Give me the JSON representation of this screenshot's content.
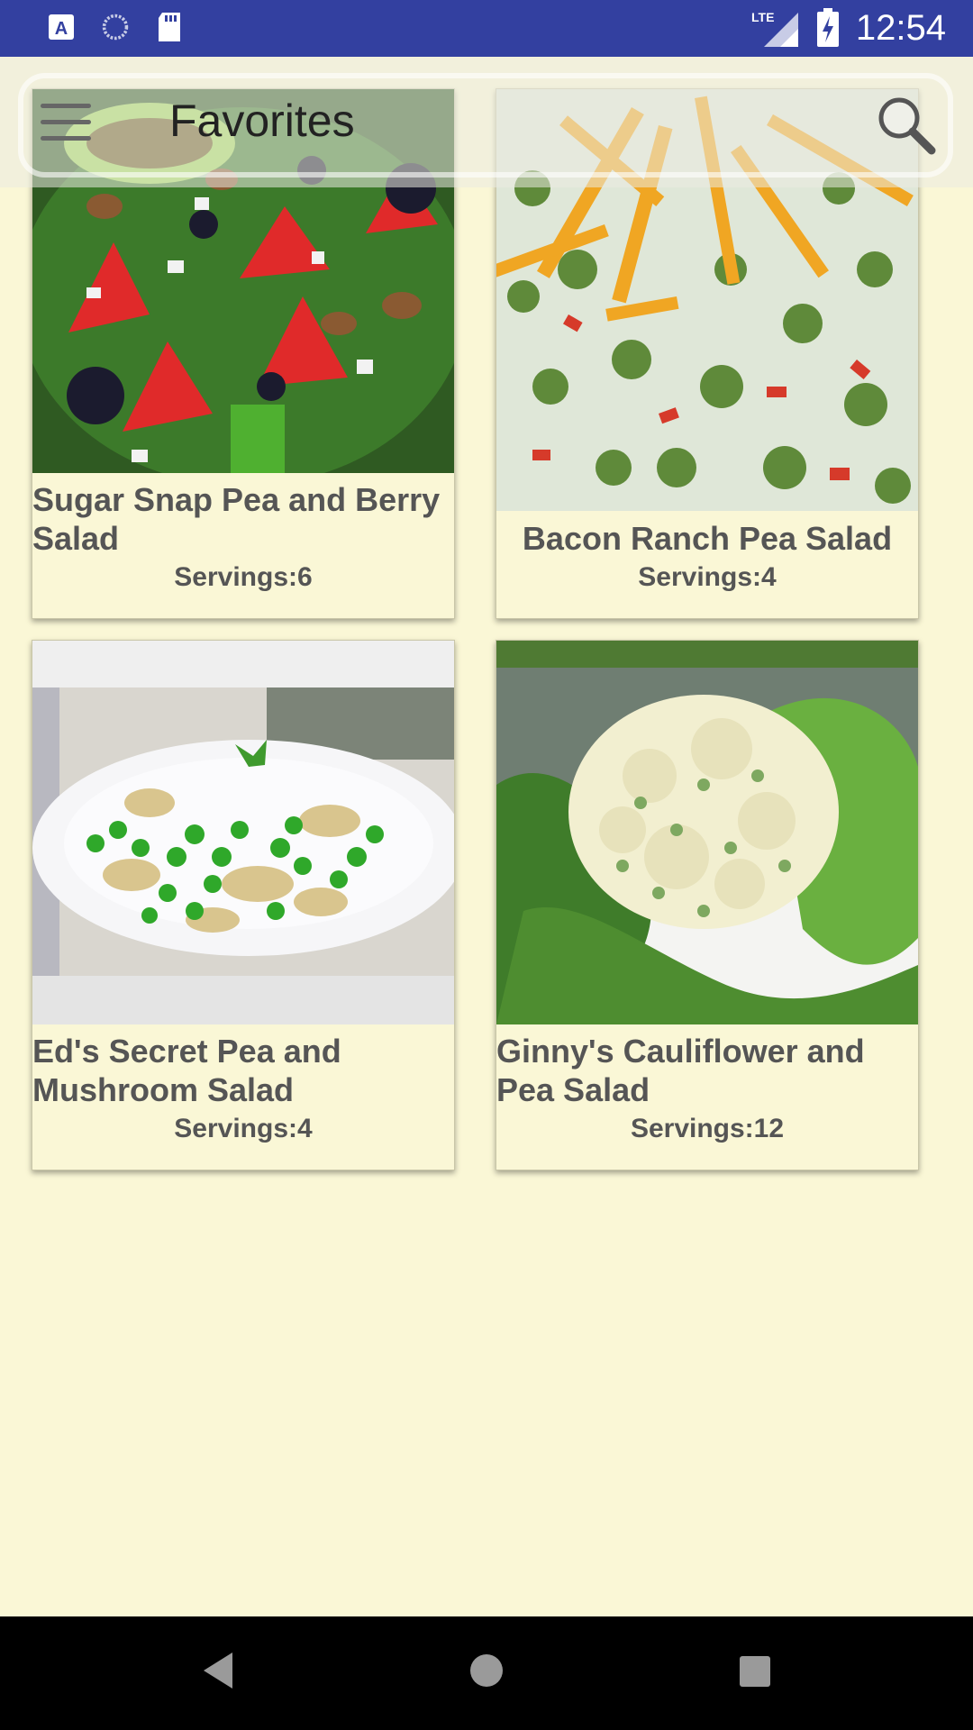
{
  "status_bar": {
    "time": "12:54",
    "left_icons": [
      "a-notification-icon",
      "sync-progress-icon",
      "sd-card-icon"
    ],
    "right_icons": [
      "lte-signal-icon",
      "battery-charging-icon"
    ]
  },
  "app_bar": {
    "title": "Favorites",
    "menu_icon": "hamburger-menu-icon",
    "search_icon": "search-icon"
  },
  "recipes": [
    {
      "title": "Sugar Snap Pea and Berry Salad",
      "servings": "Servings:6"
    },
    {
      "title": "Bacon Ranch Pea Salad",
      "servings": "Servings:4"
    },
    {
      "title": "Ed's Secret Pea and Mushroom Salad",
      "servings": "Servings:4"
    },
    {
      "title": "Ginny's Cauliflower and Pea Salad",
      "servings": "Servings:12"
    }
  ],
  "nav_bar": {
    "icons": [
      "back-triangle-icon",
      "home-circle-icon",
      "recents-square-icon"
    ]
  },
  "colors": {
    "status_bar": "#3340A0",
    "background": "#FAF7D6",
    "text": "#555555"
  }
}
